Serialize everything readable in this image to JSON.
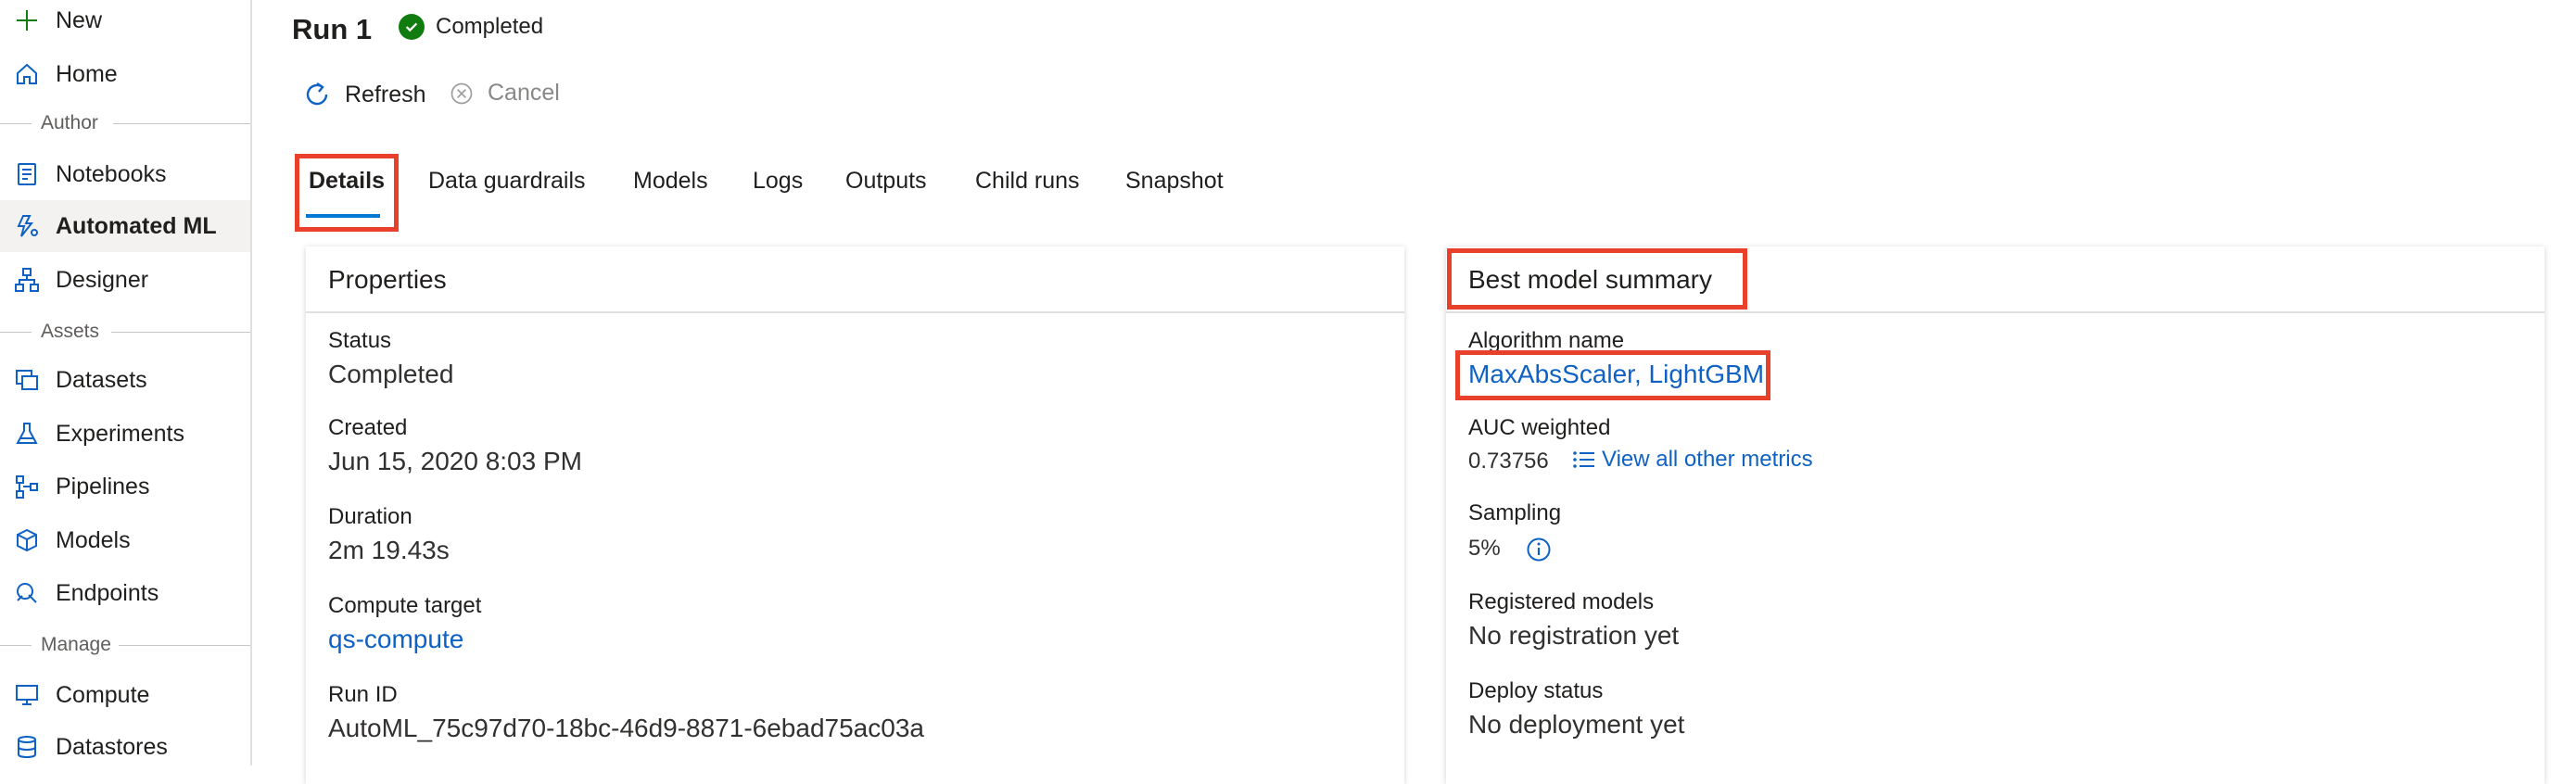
{
  "sidebar": {
    "new_label": "New",
    "home_label": "Home",
    "sections": {
      "author": "Author",
      "assets": "Assets",
      "manage": "Manage"
    },
    "author_items": [
      {
        "label": "Notebooks",
        "icon": "notebook-icon"
      },
      {
        "label": "Automated ML",
        "icon": "automated-ml-icon",
        "active": true
      },
      {
        "label": "Designer",
        "icon": "designer-icon"
      }
    ],
    "asset_items": [
      {
        "label": "Datasets",
        "icon": "datasets-icon"
      },
      {
        "label": "Experiments",
        "icon": "flask-icon"
      },
      {
        "label": "Pipelines",
        "icon": "pipeline-icon"
      },
      {
        "label": "Models",
        "icon": "cube-icon"
      },
      {
        "label": "Endpoints",
        "icon": "endpoints-icon"
      }
    ],
    "manage_items": [
      {
        "label": "Compute",
        "icon": "compute-icon"
      },
      {
        "label": "Datastores",
        "icon": "datastore-icon"
      }
    ]
  },
  "header": {
    "run_title": "Run 1",
    "status": "Completed",
    "refresh_label": "Refresh",
    "cancel_label": "Cancel"
  },
  "tabs": [
    {
      "label": "Details",
      "active": true
    },
    {
      "label": "Data guardrails"
    },
    {
      "label": "Models"
    },
    {
      "label": "Logs"
    },
    {
      "label": "Outputs"
    },
    {
      "label": "Child runs"
    },
    {
      "label": "Snapshot"
    }
  ],
  "properties": {
    "title": "Properties",
    "status_label": "Status",
    "status_value": "Completed",
    "created_label": "Created",
    "created_value": "Jun 15, 2020 8:03 PM",
    "duration_label": "Duration",
    "duration_value": "2m 19.43s",
    "compute_label": "Compute target",
    "compute_value": "qs-compute",
    "runid_label": "Run ID",
    "runid_value": "AutoML_75c97d70-18bc-46d9-8871-6ebad75ac03a"
  },
  "best_model": {
    "title": "Best model summary",
    "algorithm_label": "Algorithm name",
    "algorithm_value": "MaxAbsScaler, LightGBM",
    "auc_label": "AUC weighted",
    "auc_value": "0.73756",
    "metrics_link": "View all other metrics",
    "sampling_label": "Sampling",
    "sampling_value": "5%",
    "registered_label": "Registered models",
    "registered_value": "No registration yet",
    "deploy_label": "Deploy status",
    "deploy_value": "No deployment yet"
  },
  "colors": {
    "accent": "#0078d4",
    "link": "#0f62c4",
    "success": "#107c10",
    "highlight": "#e8402a"
  }
}
